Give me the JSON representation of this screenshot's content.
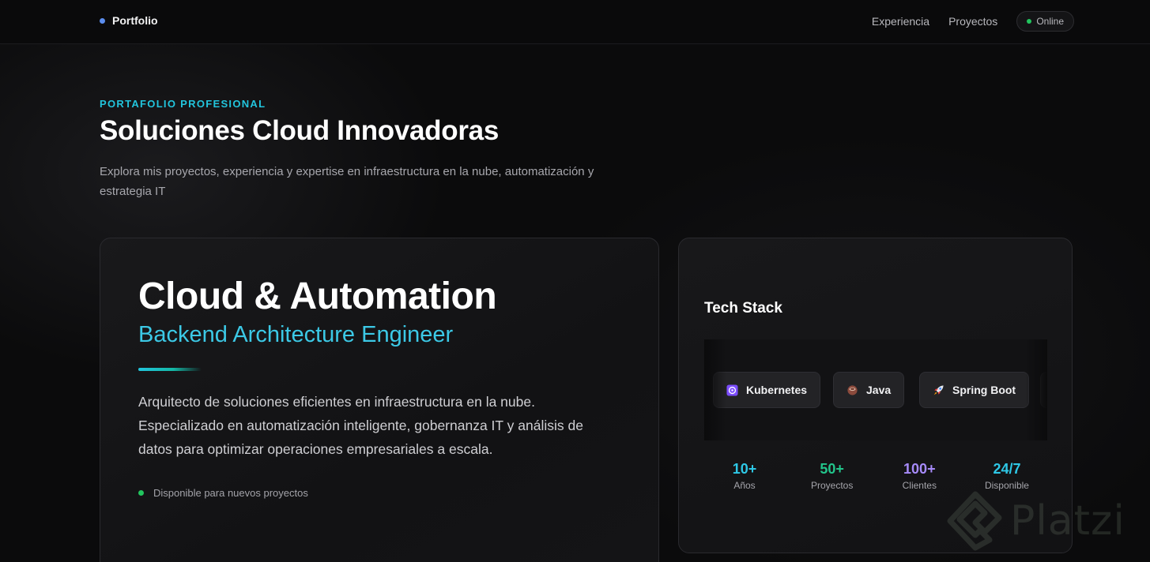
{
  "nav": {
    "brand": "Portfolio",
    "links": [
      "Experiencia",
      "Proyectos"
    ],
    "status": "Online"
  },
  "hero": {
    "eyebrow": "PORTAFOLIO PROFESIONAL",
    "title": "Soluciones Cloud Innovadoras",
    "subtitle": "Explora mis proyectos, experiencia y expertise en infraestructura en la nube, automatización y estrategia IT"
  },
  "main_card": {
    "title": "Cloud & Automation",
    "role": "Backend Architecture Engineer",
    "description": "Arquitecto de soluciones eficientes en infraestructura en la nube. Especializado en automatización inteligente, gobernanza IT y análisis de datos para optimizar operaciones empresariales a escala.",
    "availability": "Disponible para nuevos proyectos"
  },
  "tech_card": {
    "title": "Tech Stack",
    "chips": [
      {
        "label": "Kubernetes",
        "icon": "kubernetes-icon"
      },
      {
        "label": "Java",
        "icon": "coffee-icon"
      },
      {
        "label": "Spring Boot",
        "icon": "rocket-icon"
      }
    ],
    "stats": [
      {
        "value": "10+",
        "label": "Años",
        "color": "#2ec8e6"
      },
      {
        "value": "50+",
        "label": "Proyectos",
        "color": "#22c58b"
      },
      {
        "value": "100+",
        "label": "Clientes",
        "color": "#a78bfa"
      },
      {
        "value": "24/7",
        "label": "Disponible",
        "color": "#2ec8e6"
      }
    ]
  },
  "watermark": "Platzi",
  "colors": {
    "accent": "#22c5dd",
    "brand_dot": "#5b8dee",
    "status_green": "#22c55e"
  }
}
